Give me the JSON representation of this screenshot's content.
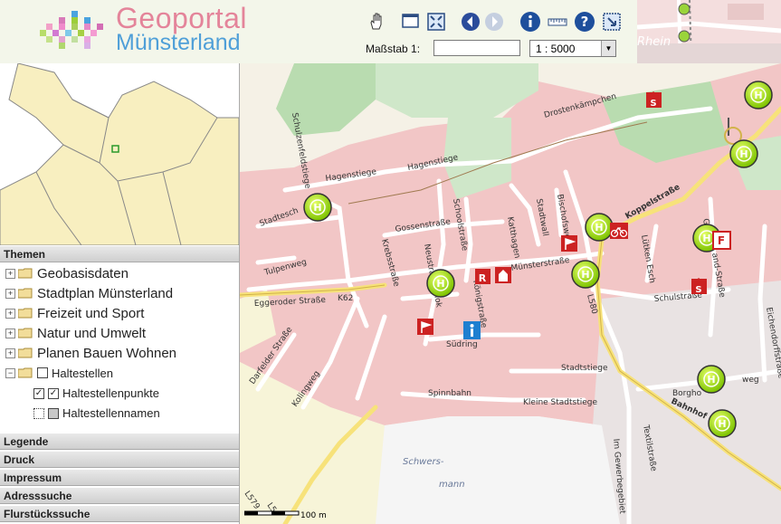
{
  "header": {
    "title_line1": "Geoportal",
    "title_line2": "Münsterland",
    "tools": [
      {
        "name": "pan-hand-icon"
      },
      {
        "name": "zoom-box-icon"
      },
      {
        "name": "full-extent-icon"
      },
      {
        "name": "back-arrow-icon"
      },
      {
        "name": "forward-arrow-icon"
      },
      {
        "name": "info-icon"
      },
      {
        "name": "measure-icon"
      },
      {
        "name": "help-icon"
      },
      {
        "name": "print-area-icon"
      }
    ],
    "scale_label": "Maßstab 1:",
    "scale_input_value": "",
    "scale_select_value": "1 : 5000"
  },
  "sidebar": {
    "panel_themen": "Themen",
    "tree": [
      {
        "label": "Geobasisdaten"
      },
      {
        "label": "Stadtplan Münsterland"
      },
      {
        "label": "Freizeit und Sport"
      },
      {
        "label": "Natur und Umwelt"
      },
      {
        "label": "Planen Bauen Wohnen"
      }
    ],
    "haltestellen": "Haltestellen",
    "haltestellenpunkte": "Haltestellenpunkte",
    "haltestellennamen": "Haltestellennamen",
    "panels": [
      "Legende",
      "Druck",
      "Impressum",
      "Adresssuche",
      "Flurstückssuche"
    ]
  },
  "map": {
    "streets": {
      "drostenkaempchen": "Drostenkämpchen",
      "hagenstiege1": "Hagenstiege",
      "hagenstiege2": "Hagenstiege",
      "schulzenfeld": "Schulzenfeldstiege",
      "stadtesch": "Stadtesch",
      "tulpenweg": "Tulpenweg",
      "eggeroder": "Eggeroder Straße",
      "k62": "K62",
      "krebsstrasse": "Krebsstraße",
      "gossenstrasse": "Gossenstraße",
      "neustrasse": "Neustraße",
      "schoolstrasse": "Schoolstraße",
      "katthagen": "Katthagen",
      "stadtwall": "Stadtwall",
      "bischofsweg": "Bischofsweg",
      "muensterstrasse": "Münsterstraße",
      "koppelstrasse": "Koppelstraße",
      "luetken_esch": "Lütken Esch",
      "l580": "L580",
      "schulstrasse": "Schulstraße",
      "sudring": "Südring",
      "stadtstiege": "Stadtstiege",
      "kleine_stadtstiege": "Kleine Stadtstiege",
      "spinnbahn": "Spinnbahn",
      "darfelder": "Darfelder Straße",
      "kolingweg": "Kolingweg",
      "koenigstrasse": "Königstraße",
      "eichendorff": "Eichendorffstraße",
      "textilstrasse": "Textilstraße",
      "im_gewerbegebiet": "Im Gewerbegebiet",
      "bahnhof": "Bahnhof",
      "schwers": "Schwers-",
      "mann": "mann",
      "l579": "L579",
      "l5": "L5",
      "borghorst": "Borgho",
      "weg": "weg",
      "gr": "Gr",
      "and_strasse": "and-Straße",
      "kenhok": "kenhok"
    },
    "scalebar_label": "100 m",
    "thumb_label": "Rhein"
  },
  "colors": {
    "stop_green": "#8fd400",
    "built_up": "#f2c6c6",
    "green_area": "#b9dcb0",
    "road_yellow": "#f7e27a",
    "poi_red": "#cc2222"
  }
}
